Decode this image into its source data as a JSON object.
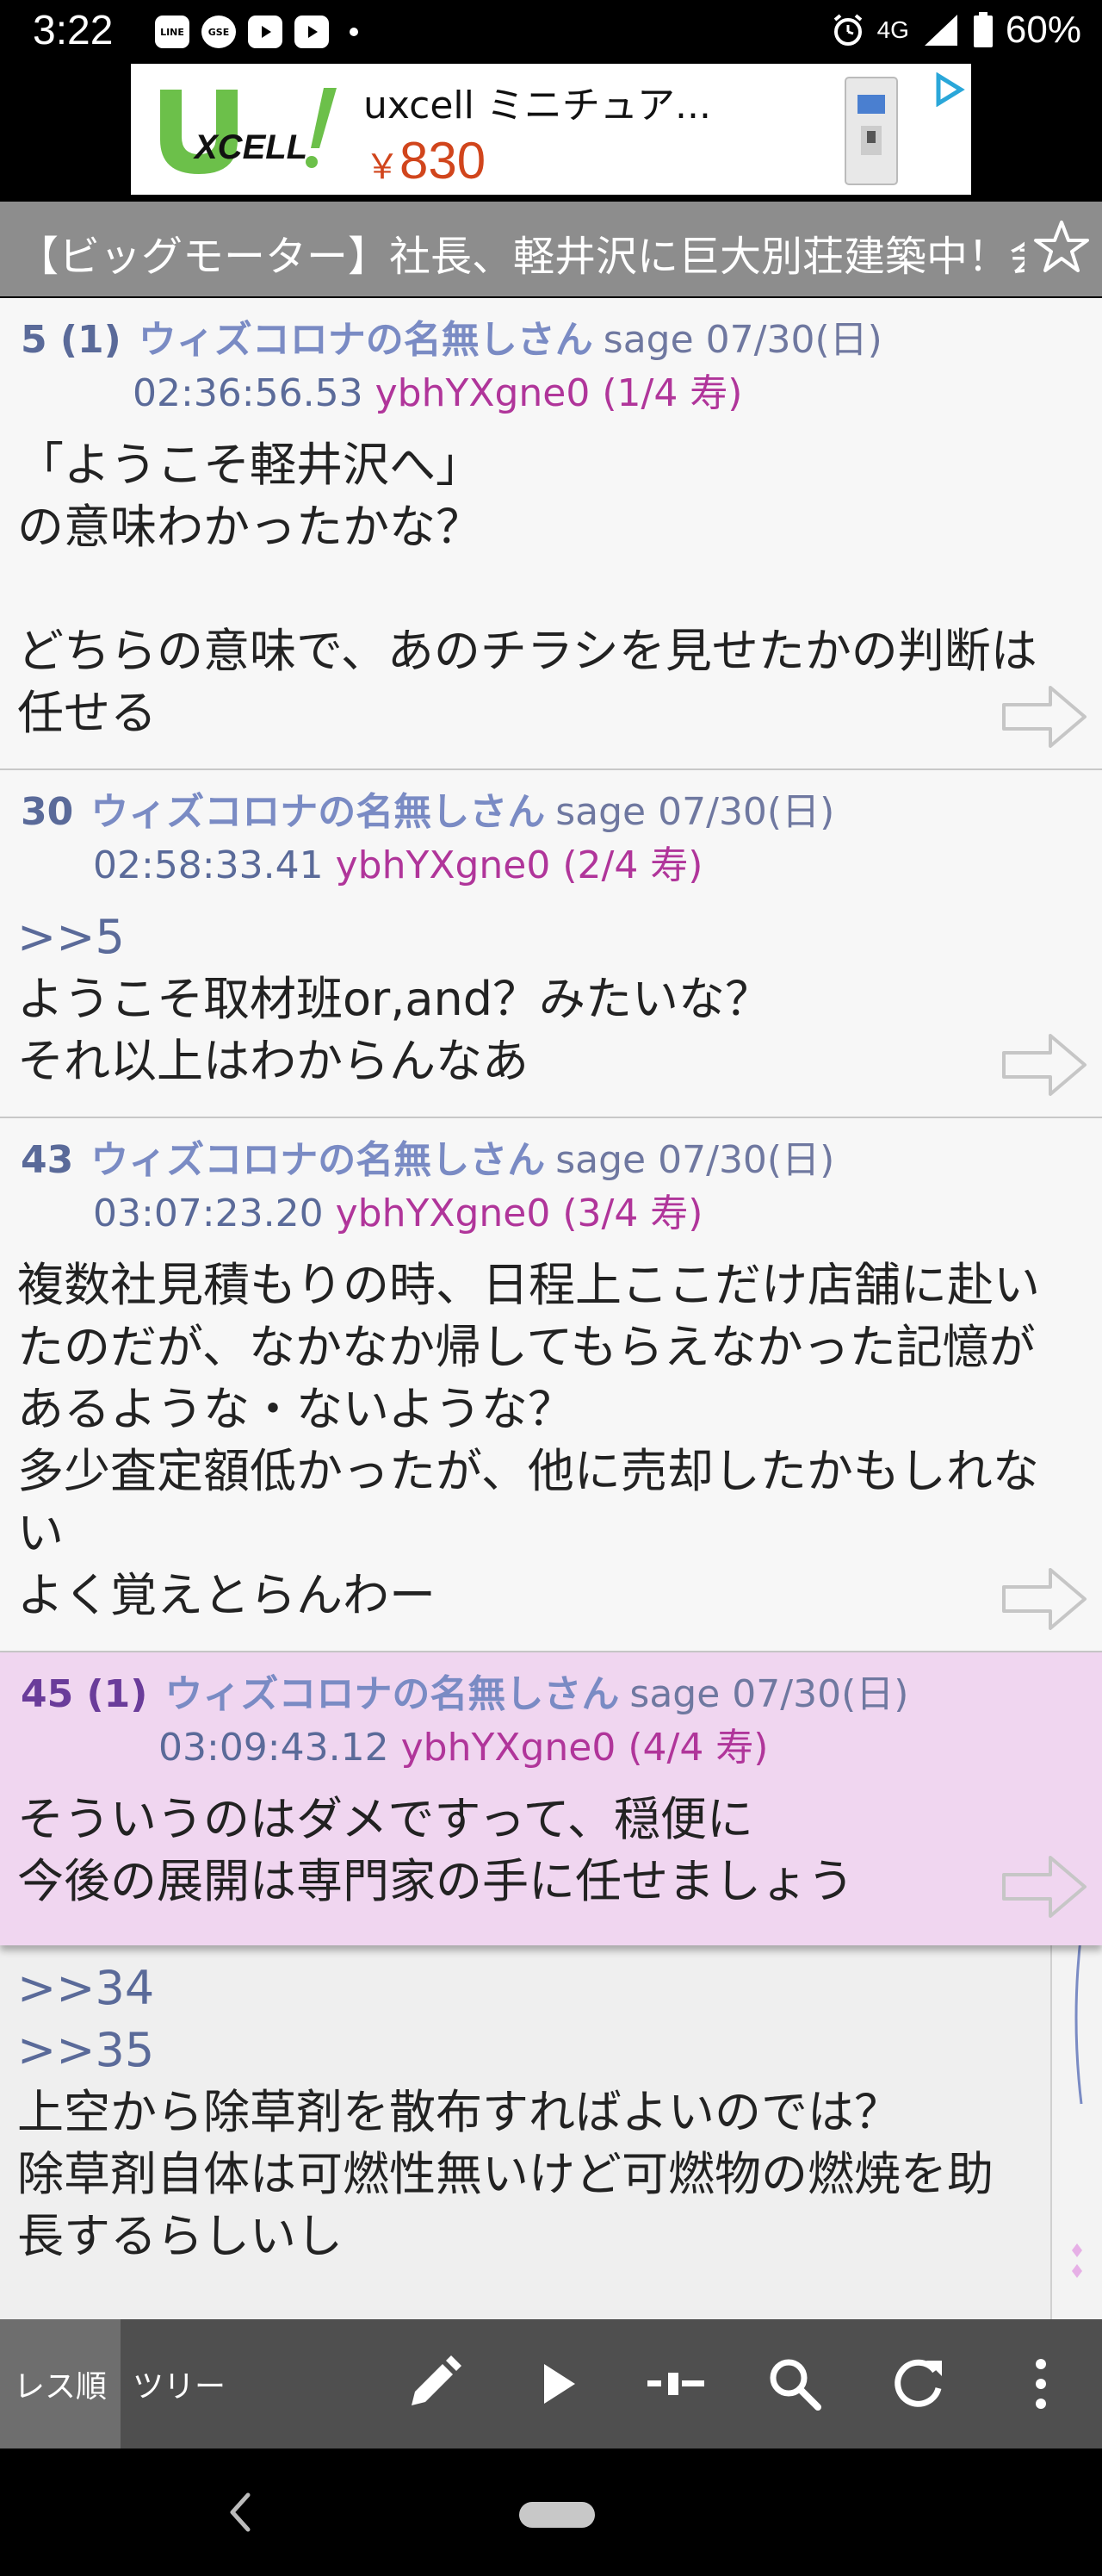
{
  "status_bar": {
    "time": "3:22",
    "notifications": [
      "LINE",
      "GSE",
      "youtube-icon",
      "youtube-icon"
    ],
    "network": "4G",
    "battery": "60%"
  },
  "ad": {
    "brand": "XCELL",
    "name": "uxcell ミニチュア...",
    "price_symbol": "￥",
    "price": "830"
  },
  "thread": {
    "title": "【ビッグモーター】社長、軽井沢に巨大別荘建築中！会"
  },
  "posts": [
    {
      "number": "5 (1)",
      "name": "ウィズコロナの名無しさん",
      "mail": "sage",
      "date": "07/30(日)",
      "time": "02:36:56.53",
      "id": "ybhYXgne0 (1/4 寿)",
      "body": "「ようこそ軽井沢へ」\nの意味わかったかな？\n\nどちらの意味で、あのチラシを見せたかの判断は任せる"
    },
    {
      "number": "30",
      "name": "ウィズコロナの名無しさん",
      "mail": "sage",
      "date": "07/30(日)",
      "time": "02:58:33.41",
      "id": "ybhYXgne0 (2/4 寿)",
      "anchor": ">>5",
      "body": "ようこそ取材班or,and？みたいな？\nそれ以上はわからんなあ"
    },
    {
      "number": "43",
      "name": "ウィズコロナの名無しさん",
      "mail": "sage",
      "date": "07/30(日)",
      "time": "03:07:23.20",
      "id": "ybhYXgne0 (3/4 寿)",
      "body": "複数社見積もりの時、日程上ここだけ店舗に赴いたのだが、なかなか帰してもらえなかった記憶があるような・ないような？\n多少査定額低かったが、他に売却したかもしれない\nよく覚えとらんわー"
    },
    {
      "number": "45 (1)",
      "name": "ウィズコロナの名無しさん",
      "mail": "sage",
      "date": "07/30(日)",
      "time": "03:09:43.12",
      "id": "ybhYXgne0 (4/4 寿)",
      "body": "そういうのはダメですって、穏便に\n今後の展開は専門家の手に任せましょう"
    }
  ],
  "underlay_post": {
    "anchor1": ">>34",
    "anchor2": ">>35",
    "body": "上空から除草剤を散布すればよいのでは？\n除草剤自体は可燃性無いけど可燃物の燃焼を助長するらしいし"
  },
  "toolbar": {
    "tab_order": "レス順",
    "tab_tree": "ツリー",
    "icons": [
      "pencil-icon",
      "play-icon",
      "jump-icon",
      "search-icon",
      "refresh-icon",
      "more-icon"
    ]
  },
  "colors": {
    "number": "#5a6a99",
    "name": "#7a8bc4",
    "id": "#b0359a",
    "highlight_bg": "#f0d6f0",
    "title_bar": "#8d8d8d",
    "toolbar": "#4f4f4f"
  }
}
